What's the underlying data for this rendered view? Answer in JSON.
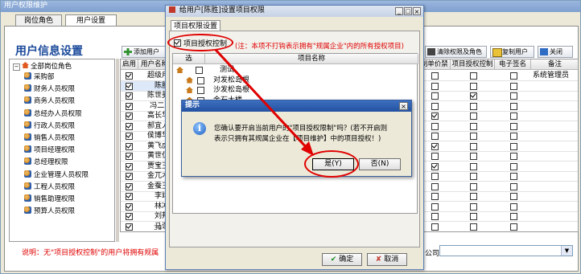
{
  "main_window": {
    "title": "用户权限维护",
    "tabs": [
      "岗位角色",
      "用户设置"
    ],
    "heading": "用户信息设置",
    "add_user_label": "添加用户",
    "clear_perm_label": "清除权限及角色",
    "copy_user_label": "复制用户",
    "close_label": "关闭",
    "tree_root": "全部岗位角色",
    "tree_items": [
      "采购部",
      "财务人员权限",
      "商务人员权限",
      "总经办人员权限",
      "行政人员权限",
      "销售人员权限",
      "项目经理权限",
      "总经理权限",
      "企业管理人员权限",
      "工程人员权限",
      "销售助理权限",
      "预算人员权限"
    ],
    "grid_headers": {
      "enable": "启用",
      "user": "用户名称"
    },
    "grid_rows": [
      "超级用",
      "陈胜",
      "陈世美",
      "冯二5",
      "高长华",
      "郝宜人",
      "侯博华",
      "黄飞虎",
      "黄世仁",
      "贾宝玉",
      "金兀术",
      "金蚕王",
      "李靖",
      "林冲",
      "刘邦",
      "马谡"
    ],
    "grid_checks": [
      true,
      true,
      true,
      true,
      true,
      true,
      true,
      true,
      true,
      true,
      true,
      true,
      true,
      true,
      true,
      true
    ],
    "row_count": "38",
    "right_headers": [
      "控制单价禁看",
      "项目授权控制",
      "电子签名",
      "备注"
    ],
    "right_remark": "系统管理员",
    "right_col1": [
      false,
      false,
      false,
      false,
      true,
      false,
      false,
      true,
      false,
      true,
      false,
      false,
      false,
      false,
      false,
      false
    ],
    "right_col2": [
      false,
      false,
      true,
      false,
      false,
      false,
      false,
      false,
      false,
      false,
      false,
      false,
      false,
      false,
      false,
      false
    ],
    "right_col3": [
      false,
      false,
      false,
      false,
      false,
      false,
      false,
      false,
      false,
      false,
      false,
      false,
      false,
      false,
      false,
      false
    ],
    "company_label": "公司",
    "note": "说明：无\"项目授权控制\"的用户将拥有规属"
  },
  "proj_dialog": {
    "title": "给用户[陈胜]设置项目权限",
    "tab": "项目权限设置",
    "checkbox_label": "项目授权控制",
    "checkbox_checked": true,
    "hint": "(注：本项不打钩表示拥有\"规属企业\"内的所有授权项目)",
    "col_select": "选",
    "col_name": "项目名称",
    "projects": [
      "测试",
      "对发松岛根",
      "沙发松岛根",
      "金石大楼"
    ],
    "ok_label": "确定",
    "cancel_label": "取消"
  },
  "prompt": {
    "title": "提示",
    "message_line1": "您确认要开启当前用户的\"项目授权限制\"吗？(若不开启则",
    "message_line2": "表示只拥有其规属企业在【项目维护】中的项目授权！)",
    "yes_label": "是(Y)",
    "no_label": "否(N)"
  }
}
